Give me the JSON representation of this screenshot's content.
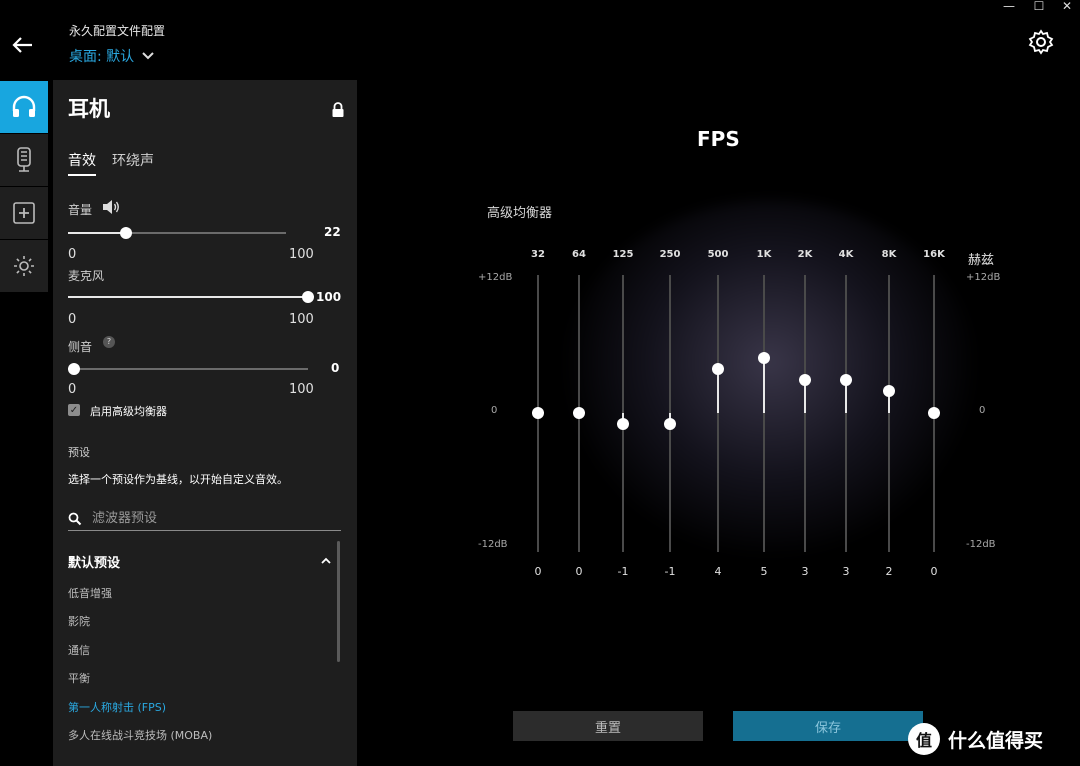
{
  "header": {
    "profile_label": "永久配置文件配置",
    "profile_value": "桌面: 默认"
  },
  "window_controls": [
    "—",
    "☐",
    "✕"
  ],
  "rail": [
    {
      "icon": "headset-icon",
      "active": true
    },
    {
      "icon": "microphone-icon",
      "active": false
    },
    {
      "icon": "add-icon",
      "active": false
    },
    {
      "icon": "lighting-icon",
      "active": false
    }
  ],
  "panel": {
    "title": "耳机",
    "tabs": [
      "音效",
      "环绕声"
    ],
    "volume": {
      "label": "音量",
      "value": "22",
      "min": "0",
      "max": "100",
      "level": 22
    },
    "mic": {
      "label": "麦克风",
      "value": "100",
      "min": "0",
      "max": "100",
      "level": 100
    },
    "sidetone": {
      "label": "侧音",
      "help": "?",
      "value": "0",
      "min": "0",
      "max": "100",
      "level": 0
    },
    "advanced_eq_checkbox": "启用高级均衡器",
    "preset_heading": "预设",
    "preset_desc": "选择一个预设作为基线，以开始自定义音效。",
    "search_placeholder": "滤波器预设",
    "default_presets_heading": "默认预设",
    "presets": [
      "低音增强",
      "影院",
      "通信",
      "平衡",
      "第一人称射击 (FPS)",
      "多人在线战斗竞技场 (MOBA)"
    ],
    "active_preset": "第一人称射击 (FPS)"
  },
  "eq": {
    "title": "FPS",
    "label": "高级均衡器",
    "unit": "赫兹",
    "db_top": "+12dB",
    "db_mid": "0",
    "db_bottom": "-12dB",
    "bands": [
      {
        "freq": "32",
        "value": 0
      },
      {
        "freq": "64",
        "value": 0
      },
      {
        "freq": "125",
        "value": -1
      },
      {
        "freq": "250",
        "value": -1
      },
      {
        "freq": "500",
        "value": 4
      },
      {
        "freq": "1K",
        "value": 5
      },
      {
        "freq": "2K",
        "value": 3
      },
      {
        "freq": "4K",
        "value": 3
      },
      {
        "freq": "8K",
        "value": 2
      },
      {
        "freq": "16K",
        "value": 0
      }
    ]
  },
  "buttons": {
    "reset": "重置",
    "save": "保存"
  },
  "watermark": {
    "circle": "值",
    "text": "什么值得买"
  }
}
